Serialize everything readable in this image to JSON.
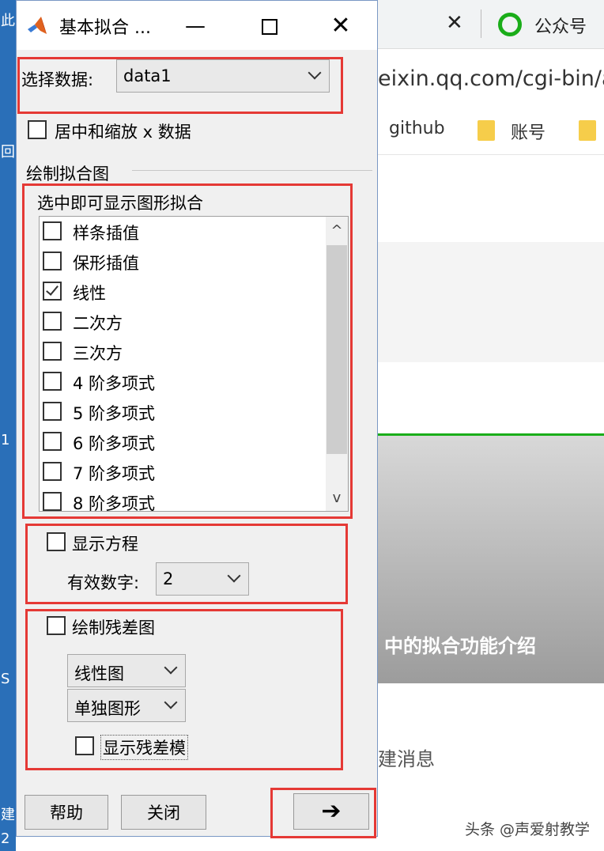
{
  "background": {
    "left_fragments": [
      "此",
      "回",
      "1",
      "S",
      "建",
      "2"
    ],
    "tab_close": "✕",
    "tab_title": "公众号",
    "url_text": "eixin.qq.com/cgi-bin/a",
    "bookmarks": [
      "github",
      "账号"
    ],
    "card_caption": "中的拟合功能介绍",
    "message_text": "建消息",
    "watermark": "头条 @声爱射教学"
  },
  "dialog": {
    "title": "基本拟合 ...",
    "controls": {
      "minimize": "—",
      "close": "✕"
    },
    "select_data_label": "选择数据:",
    "select_data_value": "data1",
    "center_scale_label": "居中和缩放 x 数据",
    "center_scale_checked": false,
    "plot_fits_heading": "绘制拟合图",
    "fits_hint": "选中即可显示图形拟合",
    "fits": [
      {
        "label": "样条插值",
        "checked": false
      },
      {
        "label": "保形插值",
        "checked": false
      },
      {
        "label": "线性",
        "checked": true
      },
      {
        "label": "二次方",
        "checked": false
      },
      {
        "label": "三次方",
        "checked": false
      },
      {
        "label": "4 阶多项式",
        "checked": false
      },
      {
        "label": "5 阶多项式",
        "checked": false
      },
      {
        "label": "6 阶多项式",
        "checked": false
      },
      {
        "label": "7 阶多项式",
        "checked": false
      },
      {
        "label": "8 阶多项式",
        "checked": false
      }
    ],
    "scroll_up": "^",
    "scroll_down": "v",
    "show_equation_label": "显示方程",
    "show_equation_checked": false,
    "sig_digits_label": "有效数字:",
    "sig_digits_value": "2",
    "plot_residuals_label": "绘制残差图",
    "plot_residuals_checked": false,
    "residual_plot_type": "线性图",
    "residual_plot_location": "单独图形",
    "show_residual_norm_label": "显示残差模",
    "show_residual_norm_checked": false,
    "help_button": "帮助",
    "close_button": "关闭",
    "next_button": "➔"
  },
  "colors": {
    "highlight_red": "#e53935",
    "wechat_green": "#1aad19",
    "dialog_bg": "#f0f0f0"
  }
}
